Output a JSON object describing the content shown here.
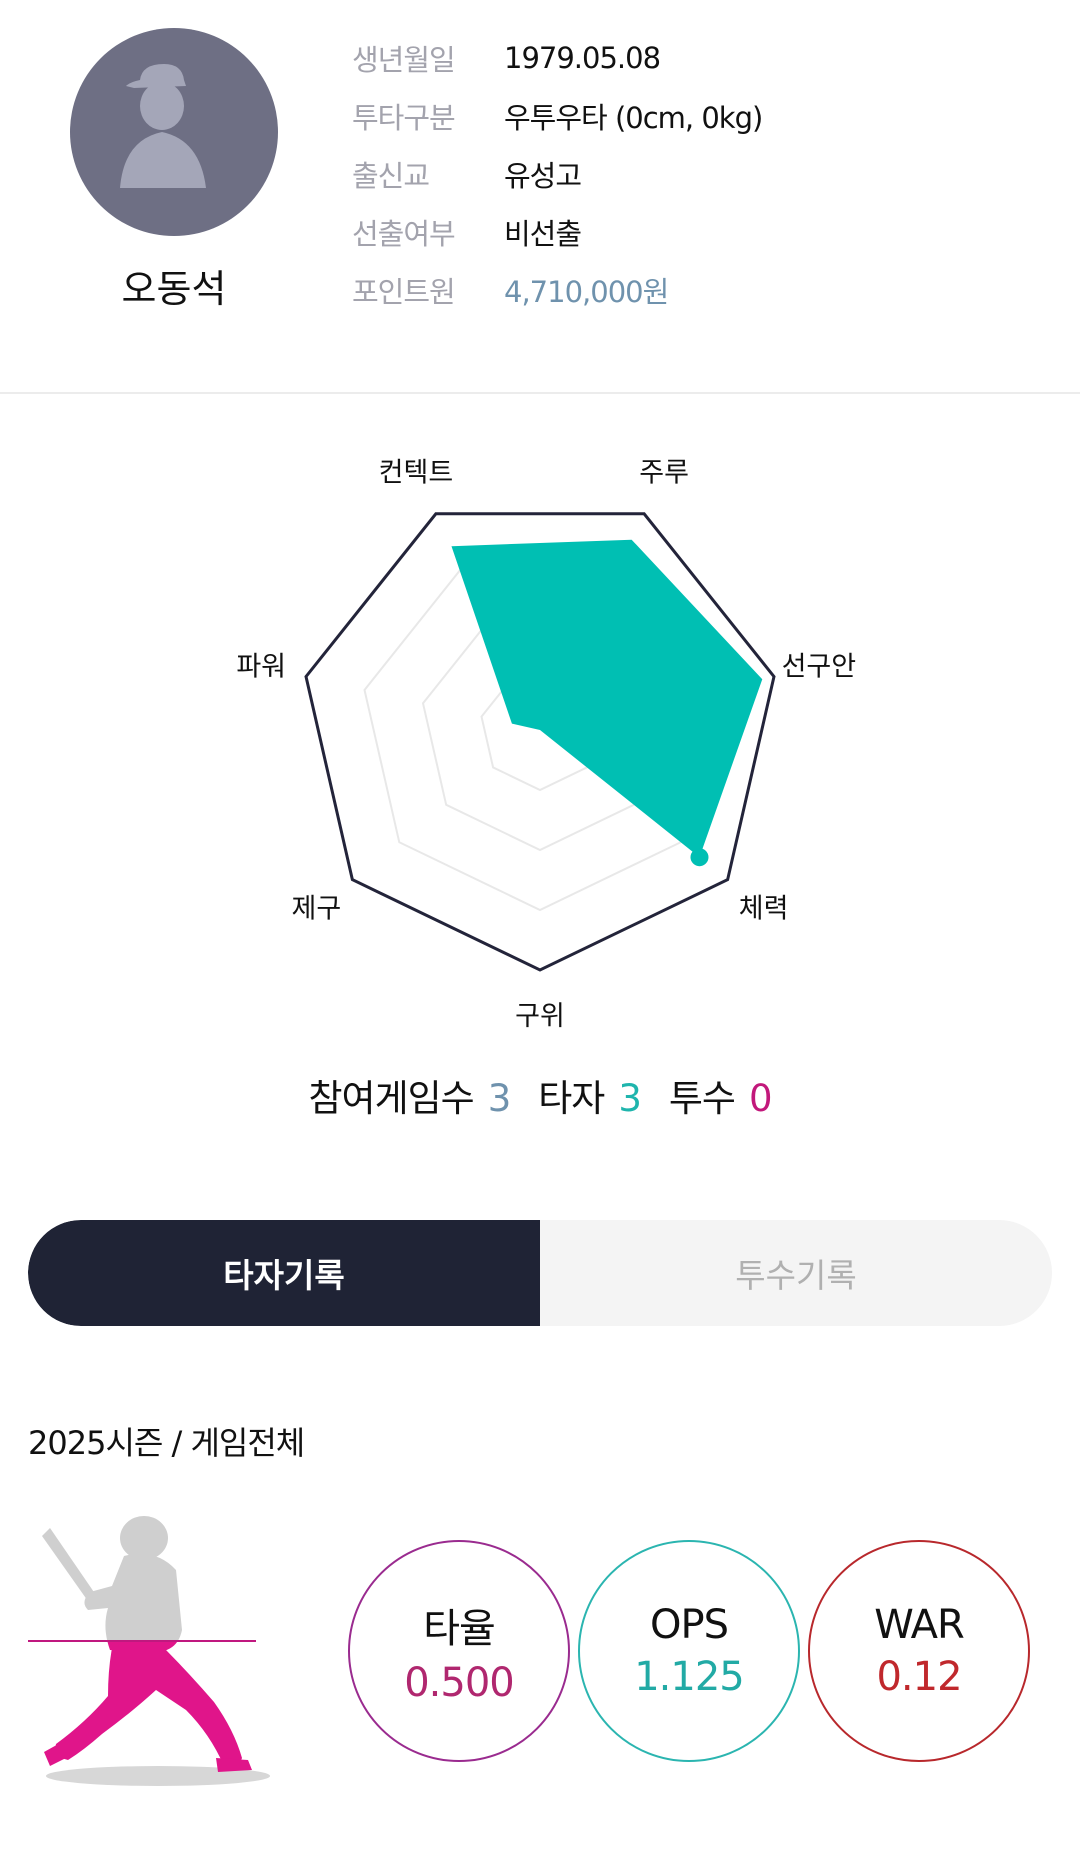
{
  "profile": {
    "name": "오동석",
    "info": [
      {
        "label": "생년월일",
        "value": "1979.05.08"
      },
      {
        "label": "투타구분",
        "value": "우투우타 (0cm, 0kg)"
      },
      {
        "label": "출신교",
        "value": "유성고"
      },
      {
        "label": "선출여부",
        "value": "비선출"
      },
      {
        "label": "포인트원",
        "value": "4,710,000원"
      }
    ],
    "avatar_icon": "player-silhouette-icon"
  },
  "radar": {
    "axes": [
      "컨텍트",
      "주루",
      "선구안",
      "체력",
      "구위",
      "제구",
      "파워"
    ],
    "values": [
      0.85,
      0.88,
      0.95,
      0.85,
      0.0,
      0.0,
      0.12
    ],
    "fill_color": "#00bfb3",
    "outline_color": "#23243a"
  },
  "games": {
    "played_label": "참여게임수",
    "played": "3",
    "batter_label": "타자",
    "batter": "3",
    "pitcher_label": "투수",
    "pitcher": "0",
    "colors": {
      "played": "#6f92ad",
      "batter": "#1fb5ad",
      "pitcher": "#c2187b"
    }
  },
  "tabs": {
    "batting": "타자기록",
    "pitching": "투수기록"
  },
  "season": "2025시즌 / 게임전체",
  "stats": [
    {
      "label": "타율",
      "value": "0.500",
      "color": "#b0276f",
      "border": "#9a2b8f"
    },
    {
      "label": "OPS",
      "value": "1.125",
      "color": "#22aaa5",
      "border": "#2bb5b0"
    },
    {
      "label": "WAR",
      "value": "0.12",
      "color": "#c0282c",
      "border": "#b8282c"
    }
  ],
  "batter_icon": "batter-silhouette-icon",
  "batter_fill_ratio": 0.5
}
